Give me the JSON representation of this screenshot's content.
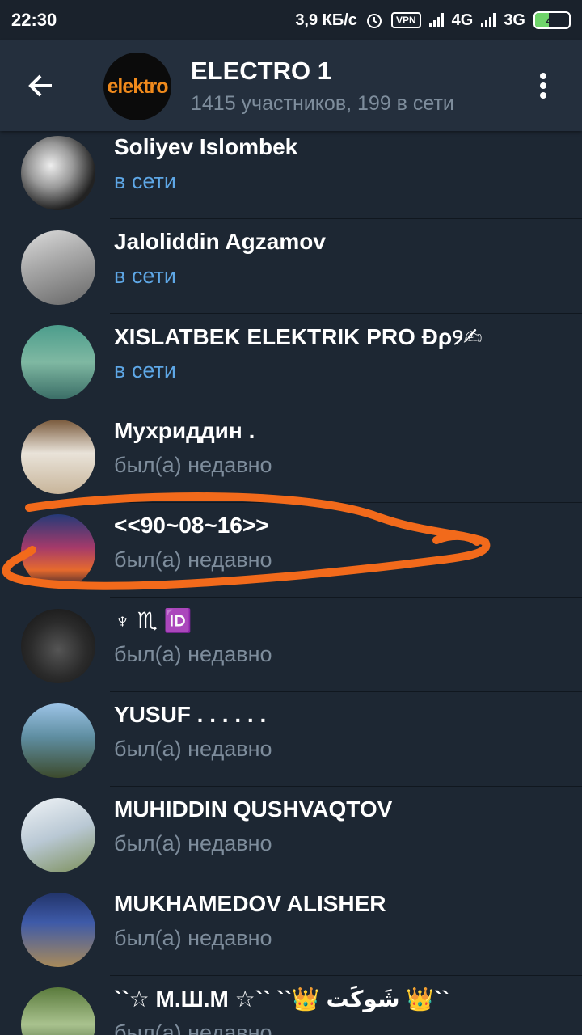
{
  "status_bar": {
    "time": "22:30",
    "speed": "3,9 КБ/с",
    "vpn": "VPN",
    "net1": "4G",
    "net2": "3G",
    "battery": "40",
    "battery_fraction": 0.4
  },
  "header": {
    "title": "ELECTRO 1",
    "subtitle": "1415 участников, 199 в сети",
    "avatar_text": "elektro",
    "back_icon": "arrow-left-icon",
    "menu_icon": "more-vert-icon"
  },
  "members": [
    {
      "name": "Soliyev Islombek",
      "status": "в сети",
      "online": true
    },
    {
      "name": "Jaloliddin Agzamov",
      "status": "в сети",
      "online": true
    },
    {
      "name": "XISLATBEK ELEKTRIK PRO Ɖρ୨✍",
      "status": "в сети",
      "online": true
    },
    {
      "name": "Мухриддин .",
      "status": "был(а) недавно",
      "online": false
    },
    {
      "name": "<<90~08~16>>",
      "status": "был(а) недавно",
      "online": false
    },
    {
      "name": "♆ ♏ 🆔",
      "status": "был(а) недавно",
      "online": false
    },
    {
      "name": "YUSUF . . . . . .",
      "status": "был(а) недавно",
      "online": false
    },
    {
      "name": "MUHIDDIN QUSHVAQTOV",
      "status": "был(а) недавно",
      "online": false
    },
    {
      "name": "MUKHAMEDOV ALISHER",
      "status": "был(а) недавно",
      "online": false
    },
    {
      "name": "``☆ М.Ш.М ☆`` ``👑 شَوکَت 👑``",
      "status": "был(а) недавно",
      "online": false
    }
  ],
  "colors": {
    "background": "#1d2733",
    "header": "#242f3d",
    "online": "#5ea7e6",
    "offline": "#7e8d9c",
    "annotation": "#f26a1b"
  }
}
